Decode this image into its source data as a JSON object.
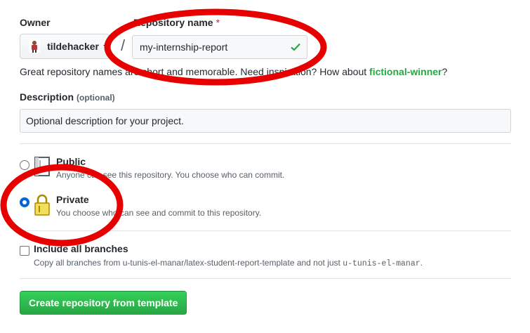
{
  "owner": {
    "label": "Owner",
    "username": "tildehacker"
  },
  "repository": {
    "label": "Repository name",
    "required_marker": "*",
    "separator": "/",
    "value": "my-internship-report",
    "hint_prefix": "Great repository names are short and memorable. Need inspiration? How about ",
    "suggestion": "fictional-winner",
    "hint_suffix": "?"
  },
  "description": {
    "label": "Description",
    "optional": "(optional)",
    "placeholder": "Optional description for your project."
  },
  "visibility": {
    "public": {
      "title": "Public",
      "desc": "Anyone can see this repository. You choose who can commit."
    },
    "private": {
      "title": "Private",
      "desc": "You choose who can see and commit to this repository.",
      "selected": true
    }
  },
  "branches": {
    "label": "Include all branches",
    "desc_prefix": "Copy all branches from u-tunis-el-manar/latex-student-report-template and not just ",
    "desc_code": "u-tunis-el-manar",
    "desc_suffix": "."
  },
  "submit": {
    "label": "Create repository from template"
  },
  "colors": {
    "accent_green": "#28a745",
    "selected_radio": "#0366d6",
    "annotation_red": "#e60000"
  }
}
